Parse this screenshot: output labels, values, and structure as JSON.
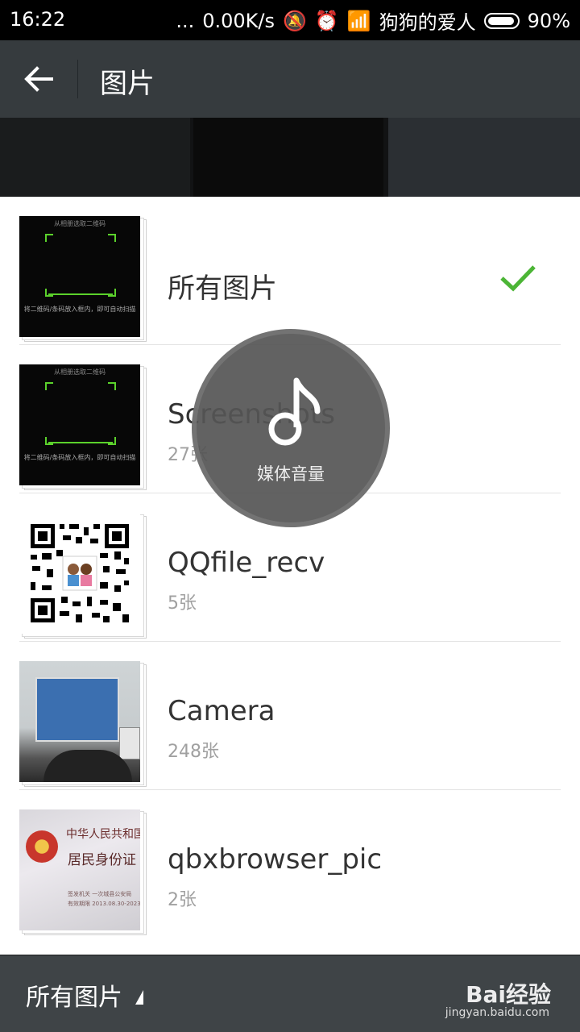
{
  "status_bar": {
    "time": "16:22",
    "dots": "...",
    "speed": "0.00K/s",
    "carrier": "狗狗的爱人",
    "battery": "90%"
  },
  "header": {
    "title": "图片"
  },
  "albums": [
    {
      "name": "所有图片",
      "count": "",
      "selected": true
    },
    {
      "name": "Screenshots",
      "count": "27张",
      "selected": false
    },
    {
      "name": "QQfile_recv",
      "count": "5张",
      "selected": false
    },
    {
      "name": "Camera",
      "count": "248张",
      "selected": false
    },
    {
      "name": "qbxbrowser_pic",
      "count": "2张",
      "selected": false
    }
  ],
  "thumbs": {
    "scan_caption_top": "从相册选取二维码",
    "scan_caption_bottom": "将二维码/条码放入框内，即可自动扫描",
    "id_line1": "中华人民共和国",
    "id_line2": "居民身份证",
    "id_line3": "签发机关  一次城县公安局",
    "id_line4": "有效期限  2013.08.30-2023.08.30"
  },
  "volume_overlay": {
    "label": "媒体音量"
  },
  "bottom_bar": {
    "filter_label": "所有图片"
  },
  "watermark": {
    "brand": "Bai经验",
    "url": "jingyan.baidu.com"
  },
  "colors": {
    "accent_check": "#4cb536",
    "titlebar": "#363b3e"
  }
}
